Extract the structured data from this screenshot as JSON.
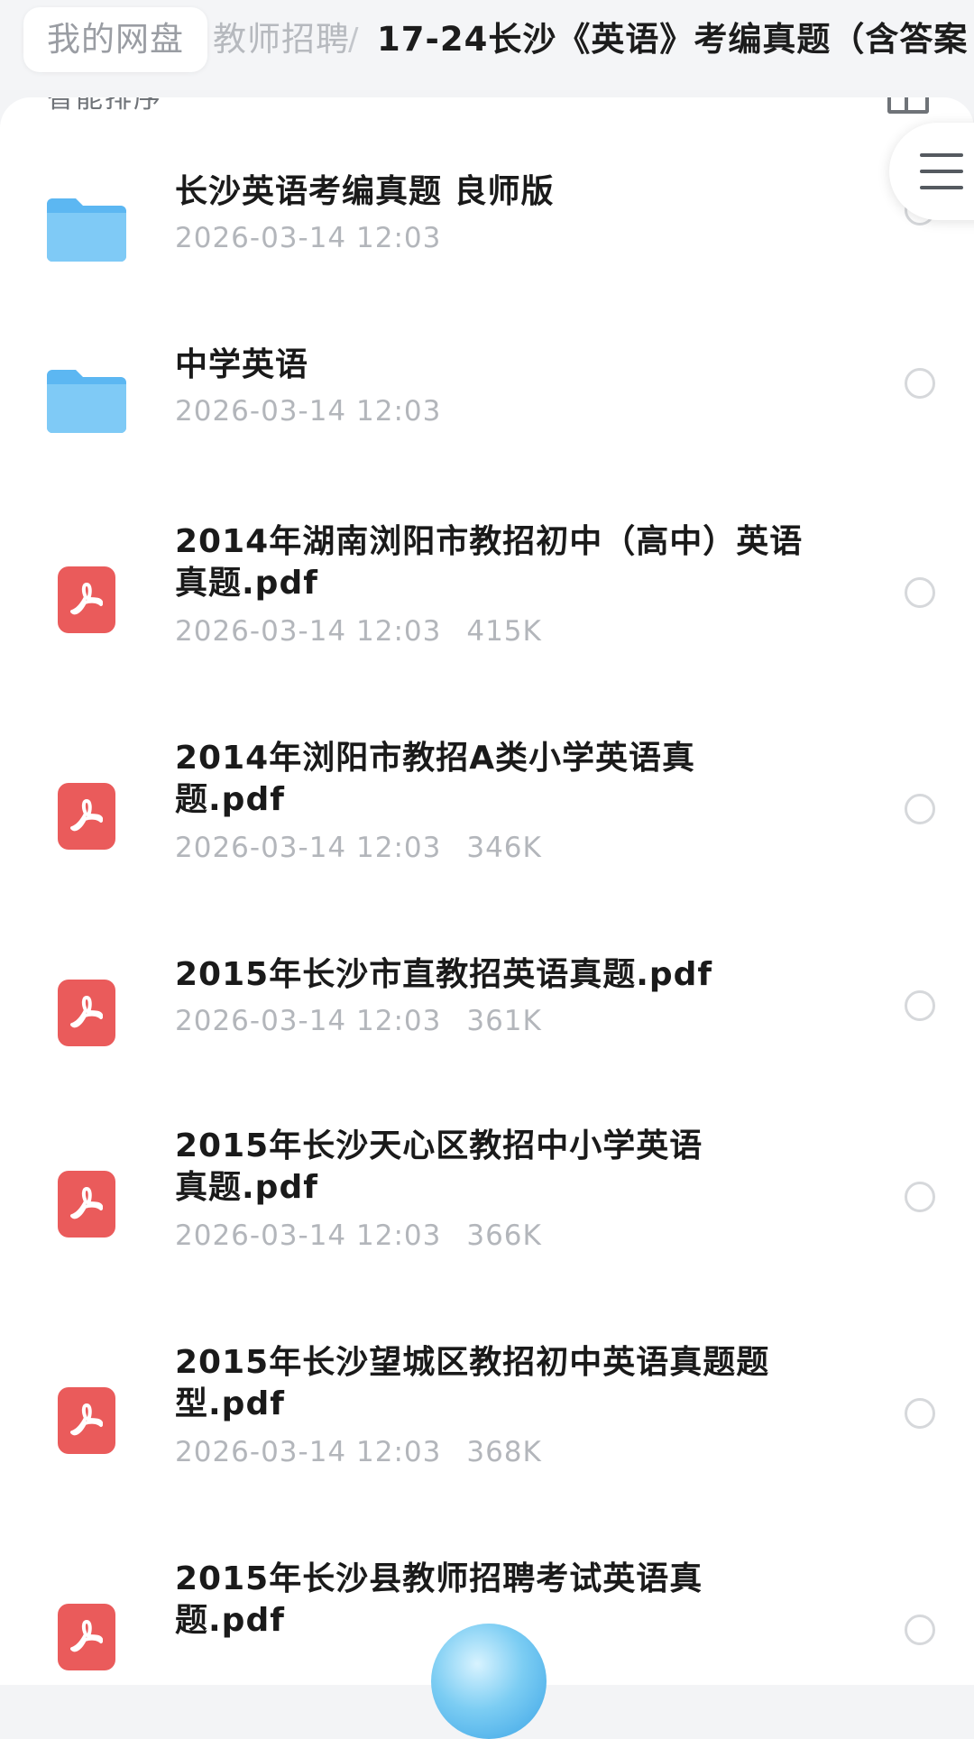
{
  "breadcrumb": {
    "home": "我的网盘",
    "parent": "教师招聘",
    "separator": "/",
    "current": "17-24长沙《英语》考编真题（含答案"
  },
  "toolbar": {
    "sort_label": "智能排序"
  },
  "colors": {
    "folder": "#5cb7f2",
    "pdf": "#ea5b5b",
    "meta_text": "#b3b6bb"
  },
  "files": [
    {
      "type": "folder",
      "icon": "folder-icon",
      "name": "长沙英语考编真题 良师版",
      "date": "2026-03-14 12:03",
      "size": ""
    },
    {
      "type": "folder",
      "icon": "folder-icon",
      "name": "中学英语",
      "date": "2026-03-14 12:03",
      "size": ""
    },
    {
      "type": "pdf",
      "icon": "pdf-icon",
      "name": "2014年湖南浏阳市教招初中（高中）英语真题.pdf",
      "date": "2026-03-14 12:03",
      "size": "415K"
    },
    {
      "type": "pdf",
      "icon": "pdf-icon",
      "name": "2014年浏阳市教招A类小学英语真题.pdf",
      "date": "2026-03-14 12:03",
      "size": "346K"
    },
    {
      "type": "pdf",
      "icon": "pdf-icon",
      "name": "2015年长沙市直教招英语真题.pdf",
      "date": "2026-03-14 12:03",
      "size": "361K"
    },
    {
      "type": "pdf",
      "icon": "pdf-icon",
      "name": "2015年长沙天心区教招中小学英语真题.pdf",
      "date": "2026-03-14 12:03",
      "size": "366K"
    },
    {
      "type": "pdf",
      "icon": "pdf-icon",
      "name": "2015年长沙望城区教招初中英语真题题型.pdf",
      "date": "2026-03-14 12:03",
      "size": "368K"
    },
    {
      "type": "pdf",
      "icon": "pdf-icon",
      "name": "2015年长沙县教师招聘考试英语真题.pdf",
      "date": "",
      "size": ""
    }
  ]
}
